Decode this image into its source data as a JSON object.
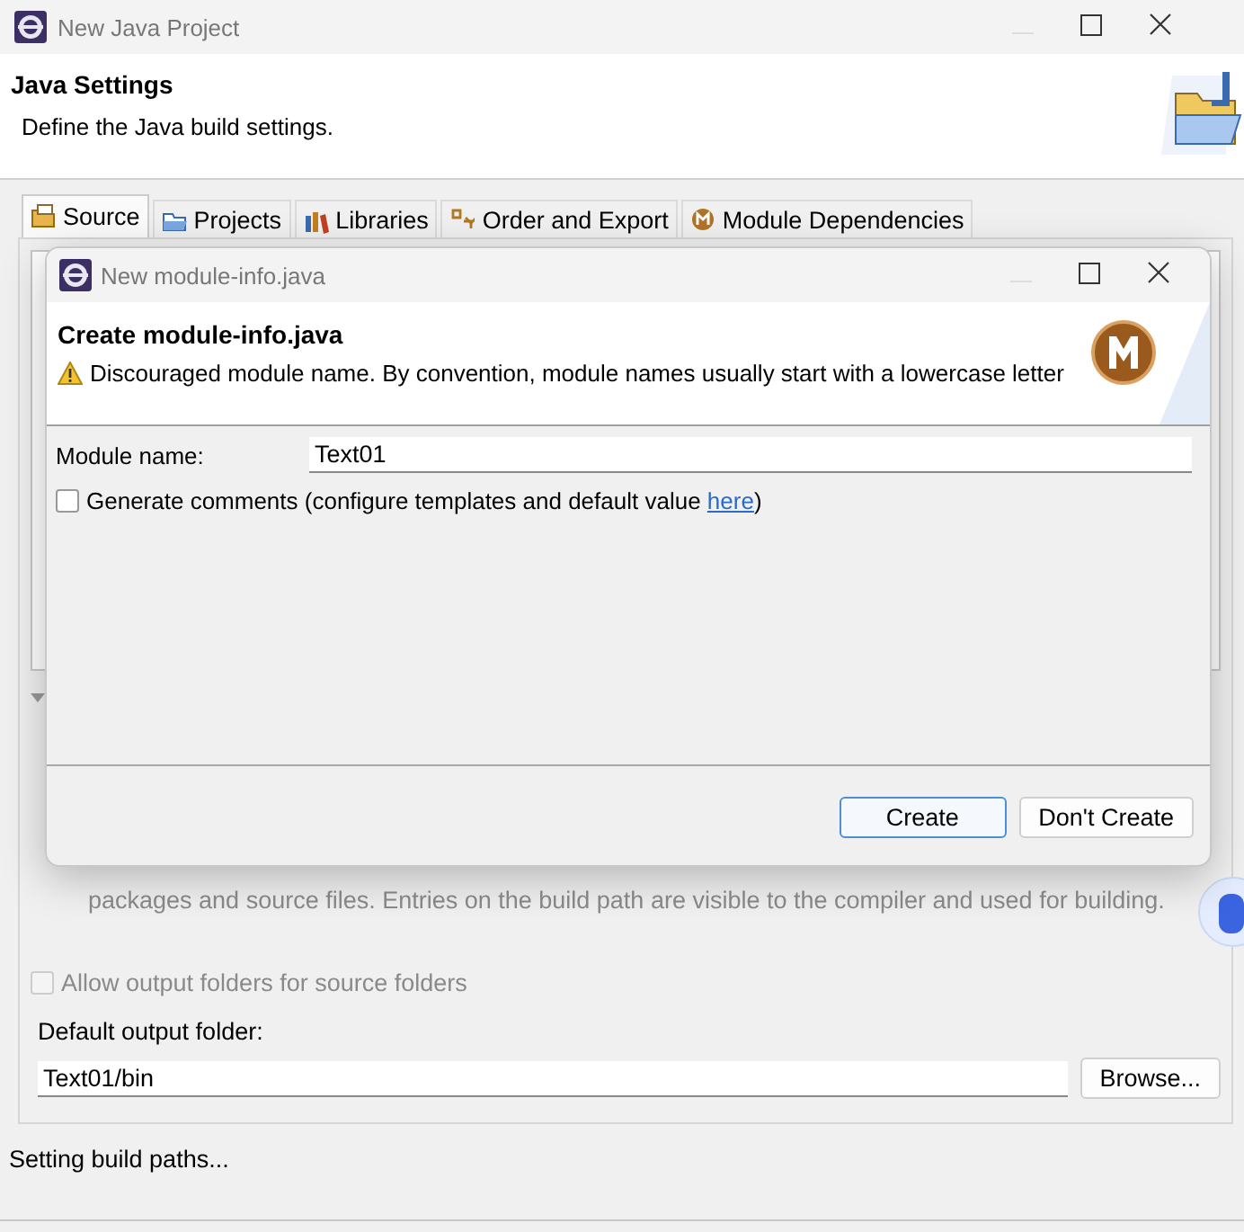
{
  "window": {
    "title": "New Java Project"
  },
  "header": {
    "title": "Java Settings",
    "description": "Define the Java build settings."
  },
  "tabs": [
    {
      "label": "Source",
      "kind": "source",
      "selected": true
    },
    {
      "label": "Projects",
      "kind": "projects",
      "selected": false
    },
    {
      "label": "Libraries",
      "kind": "libraries",
      "selected": false
    },
    {
      "label": "Order and Export",
      "kind": "order",
      "selected": false
    },
    {
      "label": "Module Dependencies",
      "kind": "module",
      "selected": false
    }
  ],
  "source_panel": {
    "info_text_2": "packages and source files. Entries on the build path are visible to the compiler and used for building.",
    "allow_output": {
      "label": "Allow output folders for source folders",
      "checked": false,
      "disabled": true
    },
    "output_folder": {
      "label": "Default output folder:",
      "value": "Text01/bin"
    },
    "browse_button": "Browse..."
  },
  "dialog": {
    "title": "New module-info.java",
    "heading": "Create module-info.java",
    "warning": "Discouraged module name. By convention, module names usually start with a lowercase letter",
    "module_name": {
      "label": "Module name:",
      "value": "Text01"
    },
    "generate_comments": {
      "checked": false,
      "text": "Generate comments (configure templates and default value ",
      "link": "here",
      "text_after": ")"
    },
    "buttons": [
      {
        "label": "Create",
        "default": true
      },
      {
        "label": "Don't Create",
        "default": false
      }
    ]
  },
  "status_bar": {
    "text": "Setting build paths..."
  }
}
